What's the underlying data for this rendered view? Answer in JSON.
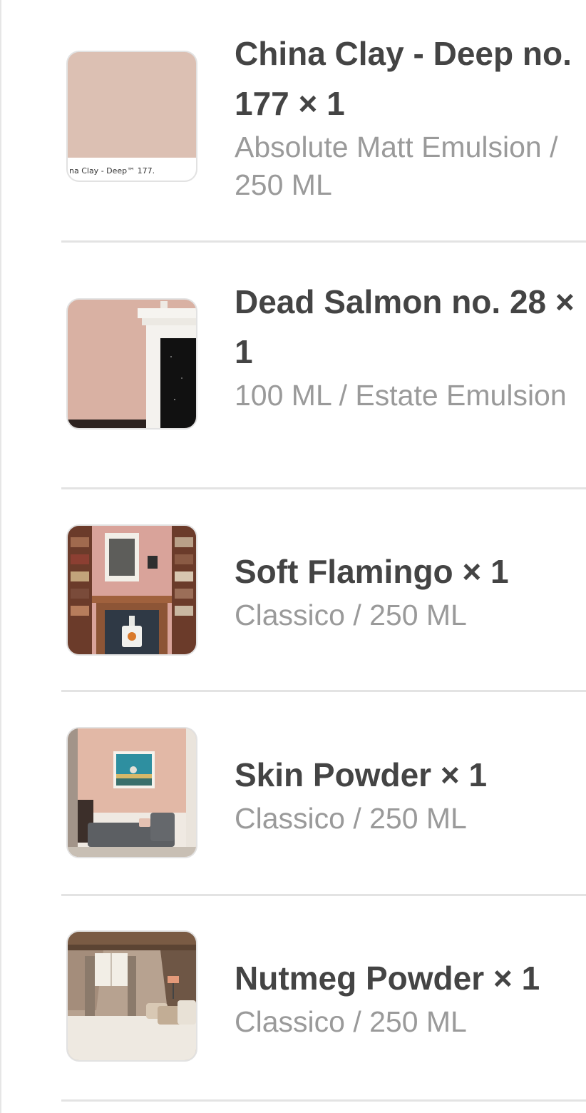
{
  "cart": {
    "items": [
      {
        "name": "China Clay - Deep no. 177 × 1",
        "variant": "Absolute Matt Emulsion / 250 ML",
        "swatch_caption": "na Clay - Deep™ 177.",
        "swatch_color": "#dcc0b3"
      },
      {
        "name": "Dead Salmon no. 28 × 1",
        "variant": "100 ML / Estate Emulsion",
        "swatch_color": "#d9b1a3"
      },
      {
        "name": "Soft Flamingo × 1",
        "variant": "Classico / 250 ML",
        "swatch_color": "#dba59c"
      },
      {
        "name": "Skin Powder × 1",
        "variant": "Classico / 250 ML",
        "swatch_color": "#e2b8a6"
      },
      {
        "name": "Nutmeg Powder × 1",
        "variant": "Classico / 250 ML",
        "swatch_color": "#c9b3a2"
      }
    ]
  }
}
